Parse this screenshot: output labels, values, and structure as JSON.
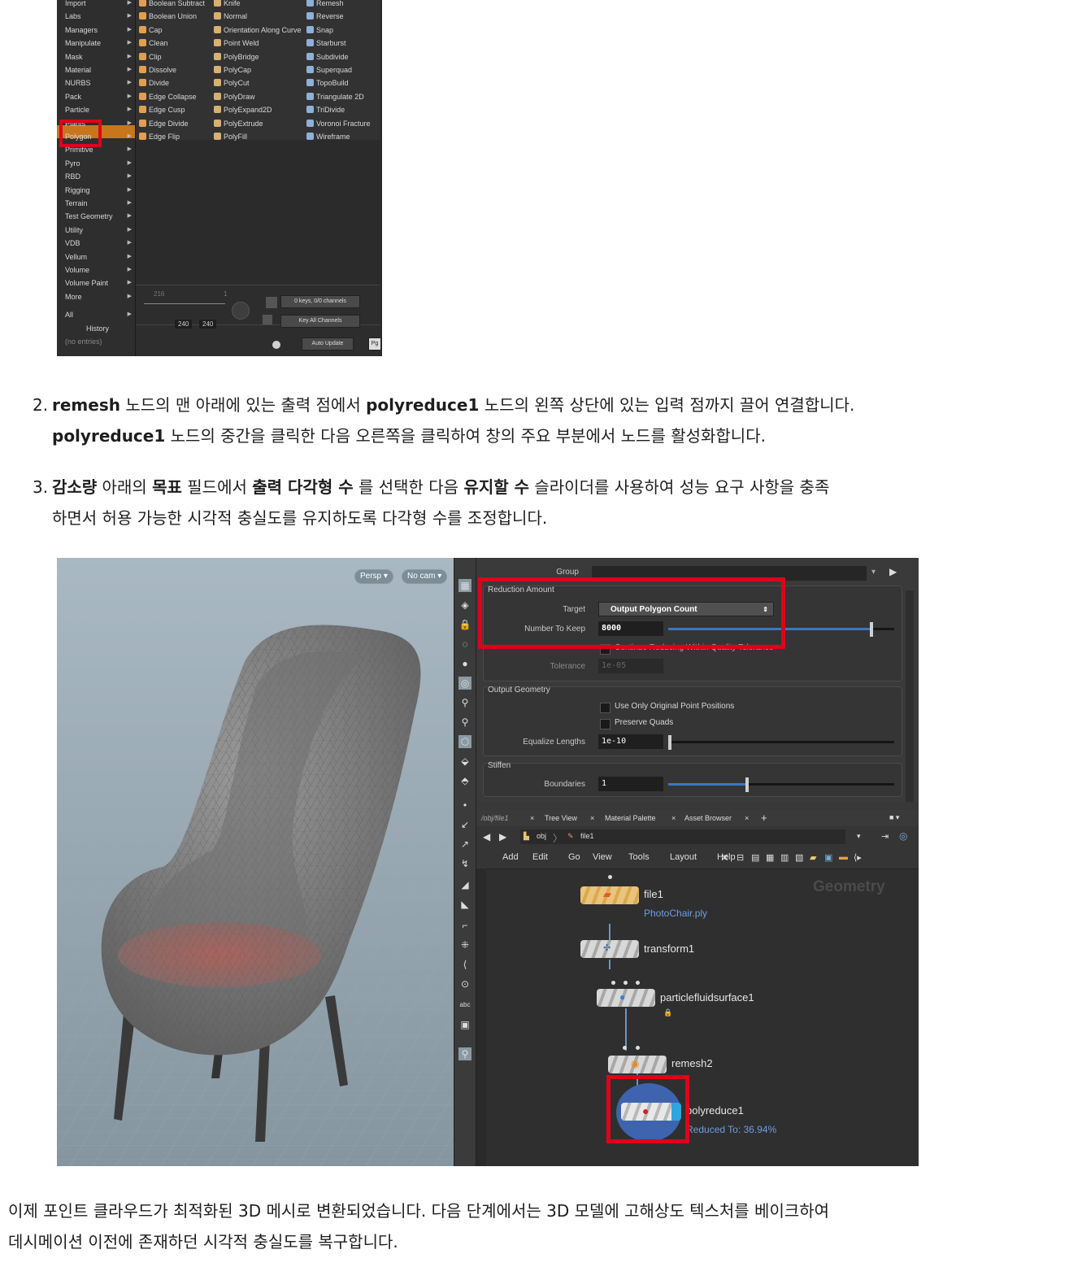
{
  "menu": {
    "categories": [
      "Import",
      "Labs",
      "Managers",
      "Manipulate",
      "Mask",
      "Material",
      "NURBS",
      "Pack",
      "Particle",
      "Plants",
      "Polygon",
      "Primitive",
      "Pyro",
      "RBD",
      "Rigging",
      "Terrain",
      "Test Geometry",
      "Utility",
      "VDB",
      "Vellum",
      "Volume",
      "Volume Paint",
      "More",
      "All",
      "History",
      "(no entries)"
    ],
    "col_a": [
      "Boolean Subtract",
      "Boolean Union",
      "Cap",
      "Clean",
      "Clip",
      "Dissolve",
      "Divide",
      "Edge Collapse",
      "Edge Cusp",
      "Edge Divide",
      "Edge Flip"
    ],
    "col_b": [
      "Knife",
      "Normal",
      "Orientation Along Curve",
      "Point Weld",
      "PolyBridge",
      "PolyCap",
      "PolyCut",
      "PolyDraw",
      "PolyExpand2D",
      "PolyExtrude",
      "PolyFill"
    ],
    "col_c": [
      "Remesh",
      "Reverse",
      "Snap",
      "Starburst",
      "Subdivide",
      "Superquad",
      "TopoBuild",
      "Triangulate 2D",
      "TriDivide",
      "Voronoi Fracture",
      "Wireframe"
    ],
    "timeline": {
      "num_a": "216",
      "num_b": "1",
      "frame_a": "240",
      "frame_b": "240",
      "keys": "0 keys, 0/0 channels",
      "key_all": "Key All Channels",
      "auto_update": "Auto Update",
      "pg": "Pg"
    }
  },
  "steps": {
    "s2": {
      "n": "2.",
      "l1a": "remesh",
      "l1b": " 노드의 맨 아래에 있는 출력 점에서 ",
      "l1c": "polyreduce1",
      "l1d": " 노드의 왼쪽 상단에 있는 입력 점까지 끌어 연결합니다.",
      "l2a": "polyreduce1",
      "l2b": " 노드의 중간을 클릭한 다음 오른쪽을 클릭하여 창의 주요 부분에서 노드를 활성화합니다."
    },
    "s3": {
      "n": "3.",
      "a": "감소량",
      "b": " 아래의 ",
      "c": "목표",
      "d": " 필드에서 ",
      "e": "출력 다각형 수",
      "f": " 를 선택한 다음 ",
      "g": "유지할 수",
      "h": " 슬라이더를 사용하여 성능 요구 사항을 충족",
      "l2": "하면서 허용 가능한 시각적 충실도를 유지하도록 다각형 수를 조정합니다."
    }
  },
  "viewport": {
    "persp": "Persp ▾",
    "cam": "No cam ▾"
  },
  "params": {
    "group_label": "Group",
    "reduction_section": "Reduction Amount",
    "target_label": "Target",
    "target_value": "Output Polygon Count",
    "keep_label": "Number To Keep",
    "keep_value": "8000",
    "keep_fraction": 0.9,
    "hidden_label": "Continue Reducing Within Quality Tolerance",
    "tolerance_label": "Tolerance",
    "tolerance_value": "1e-05",
    "output_section": "Output Geometry",
    "chk1": "Use Only Original Point Positions",
    "chk2": "Preserve Quads",
    "equalize_label": "Equalize Lengths",
    "equalize_value": "1e-10",
    "stiffen_section": "Stiffen",
    "boundaries_label": "Boundaries",
    "boundaries_value": "1",
    "boundaries_fraction": 0.35
  },
  "network": {
    "tabs": [
      "/obj/file1",
      "Tree View",
      "Material Palette",
      "Asset Browser"
    ],
    "path_obj": "obj",
    "path_file": "file1",
    "menus": [
      "Add",
      "Edit",
      "Go",
      "View",
      "Tools",
      "Layout",
      "Help"
    ],
    "watermark": "Geometry",
    "nodes": {
      "file": "file1",
      "file_sub": "PhotoChair.ply",
      "transform": "transform1",
      "pfs": "particlefluidsurface1",
      "remesh": "remesh2",
      "reduce": "polyreduce1",
      "reduce_sub": "Reduced To: 36.94%"
    }
  },
  "outro": {
    "l1": "이제 포인트 클라우드가 최적화된 3D 메시로 변환되었습니다. 다음 단계에서는 3D 모델에 고해상도 텍스처를 베이크하여",
    "l2": "데시메이션 이전에 존재하던 시각적 충실도를 복구합니다."
  },
  "colors": {
    "highlight": "#c8761c",
    "annotation_red": "#e0001b",
    "slider_blue": "#3b78c0",
    "node_link": "#6e9de0"
  }
}
